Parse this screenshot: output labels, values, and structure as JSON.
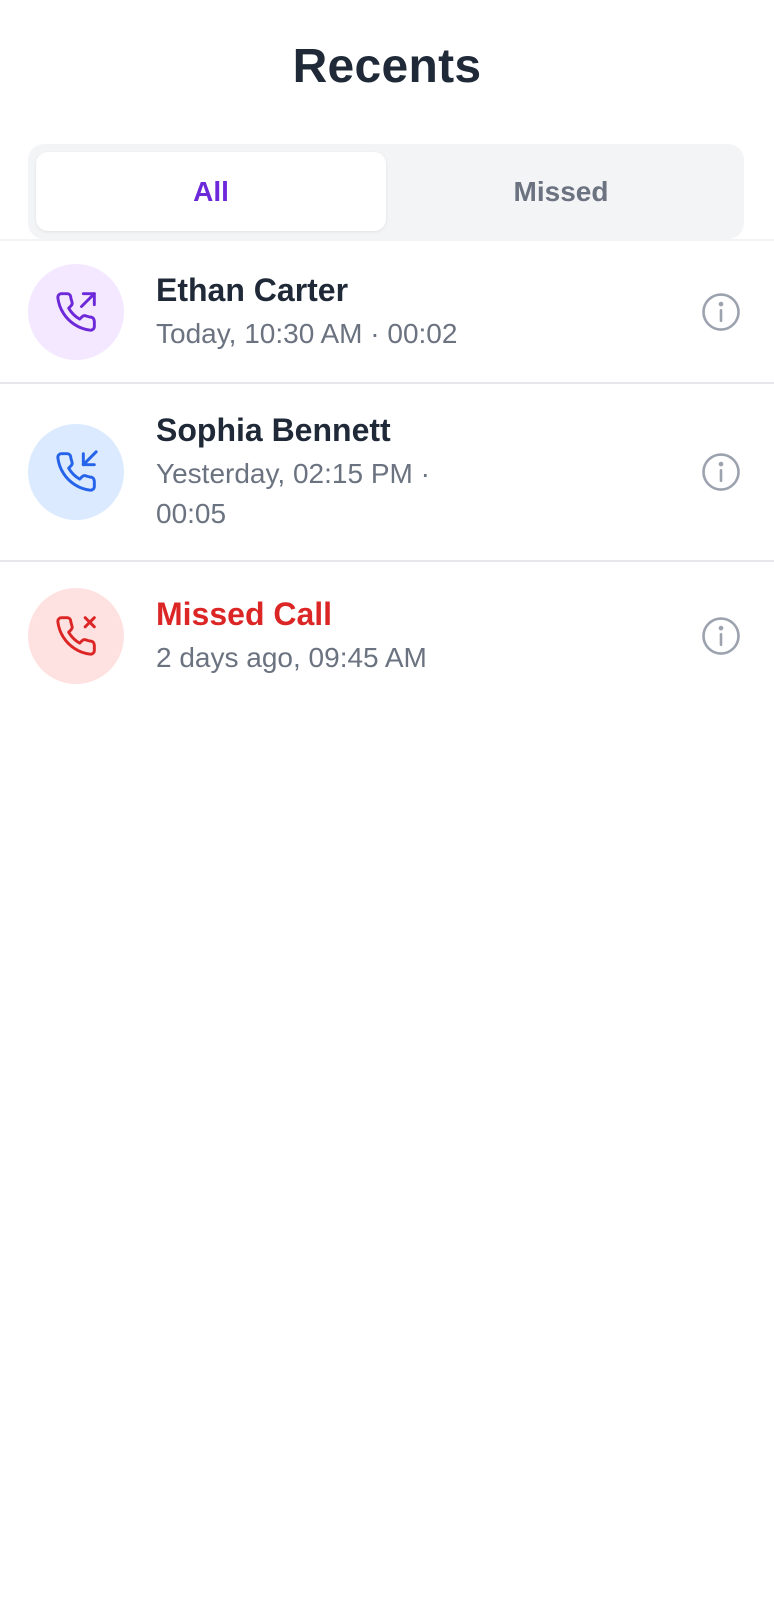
{
  "header": {
    "title": "Recents"
  },
  "tabs": [
    {
      "label": "All",
      "active": true
    },
    {
      "label": "Missed",
      "active": false
    }
  ],
  "calls": [
    {
      "name": "Ethan Carter",
      "meta": "Today, 10:30 AM · 00:02",
      "type": "outgoing",
      "icon": "phone-outgoing-icon",
      "icon_color": "#6d28d9",
      "bg_color": "#f3e8ff"
    },
    {
      "name": "Sophia Bennett",
      "meta": "Yesterday, 02:15 PM · 00:05",
      "type": "incoming",
      "icon": "phone-incoming-icon",
      "icon_color": "#2563eb",
      "bg_color": "#dbeafe"
    },
    {
      "name": "Missed Call",
      "meta": "2 days ago, 09:45 AM",
      "type": "missed",
      "icon": "phone-missed-icon",
      "icon_color": "#dc2626",
      "bg_color": "#fee2e2"
    }
  ],
  "colors": {
    "accent": "#6d28d9",
    "missed": "#dc2626",
    "text_primary": "#1f2937",
    "text_secondary": "#6b7280"
  }
}
